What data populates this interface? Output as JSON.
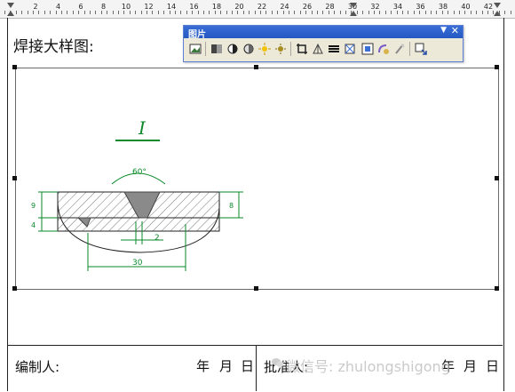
{
  "ruler": {
    "numbers": [
      "2",
      "4",
      "6",
      "8",
      "10",
      "12",
      "14",
      "16",
      "18",
      "20",
      "22",
      "24",
      "26",
      "28",
      "30",
      "32",
      "34",
      "36",
      "38",
      "40",
      "42"
    ]
  },
  "document": {
    "title": "焊接大样图:",
    "footer": {
      "prepared_by": "编制人:",
      "date_left": [
        "年",
        "月",
        "日"
      ],
      "approved_by": "批准人:",
      "date_right": [
        "年",
        "月",
        "日"
      ]
    }
  },
  "toolbar": {
    "title": "图片",
    "buttons": [
      {
        "name": "insert-picture-icon"
      },
      {
        "name": "color-icon"
      },
      {
        "name": "more-contrast-icon"
      },
      {
        "name": "less-contrast-icon"
      },
      {
        "name": "more-brightness-icon"
      },
      {
        "name": "less-brightness-icon"
      },
      {
        "name": "crop-icon"
      },
      {
        "name": "rotate-left-icon"
      },
      {
        "name": "line-style-icon"
      },
      {
        "name": "compress-pictures-icon"
      },
      {
        "name": "text-wrapping-icon"
      },
      {
        "name": "format-picture-icon"
      },
      {
        "name": "set-transparent-color-icon"
      },
      {
        "name": "reset-picture-icon"
      }
    ]
  },
  "drawing": {
    "section_label": "I",
    "angle_label": "60°",
    "left_dim_top": "9",
    "left_dim_bottom": "4",
    "right_dim": "8",
    "gap_dim": "2",
    "width_dim": "30",
    "colors": {
      "dimension": "#0a8a2a",
      "hatch": "#6b6b6b",
      "weld": "#8a8a8a",
      "outline": "#222222"
    }
  },
  "watermark": {
    "text": "微信号: zhulongshigong"
  }
}
